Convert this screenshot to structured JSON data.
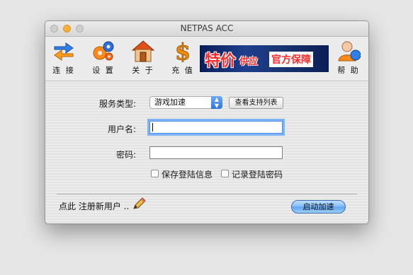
{
  "window": {
    "title": "NETPAS ACC"
  },
  "toolbar": {
    "connect": {
      "label": "连 接",
      "icon": "connect-arrows-icon"
    },
    "settings": {
      "label": "设 置",
      "icon": "gears-icon"
    },
    "about": {
      "label": "关 于",
      "icon": "house-icon"
    },
    "recharge": {
      "label": "充 值",
      "icon": "dollar-icon"
    },
    "help": {
      "label": "帮 助",
      "icon": "user-help-icon"
    }
  },
  "banner": {
    "part1": "特价",
    "part2": "供应",
    "part3": "官方保障"
  },
  "form": {
    "service_type_label": "服务类型:",
    "service_type_value": "游戏加速",
    "view_list_button": "查看支持列表",
    "username_label": "用户名:",
    "username_value": "",
    "password_label": "密码:",
    "password_value": "",
    "save_login_label": "保存登陆信息",
    "remember_password_label": "记录登陆密码"
  },
  "footer": {
    "register_link": "点此 注册新用户 ..",
    "start_button": "启动加速"
  },
  "colors": {
    "accent": "#2f74e0",
    "banner_bg": "#1e3f8f",
    "banner_text": "#ff2b2b"
  }
}
